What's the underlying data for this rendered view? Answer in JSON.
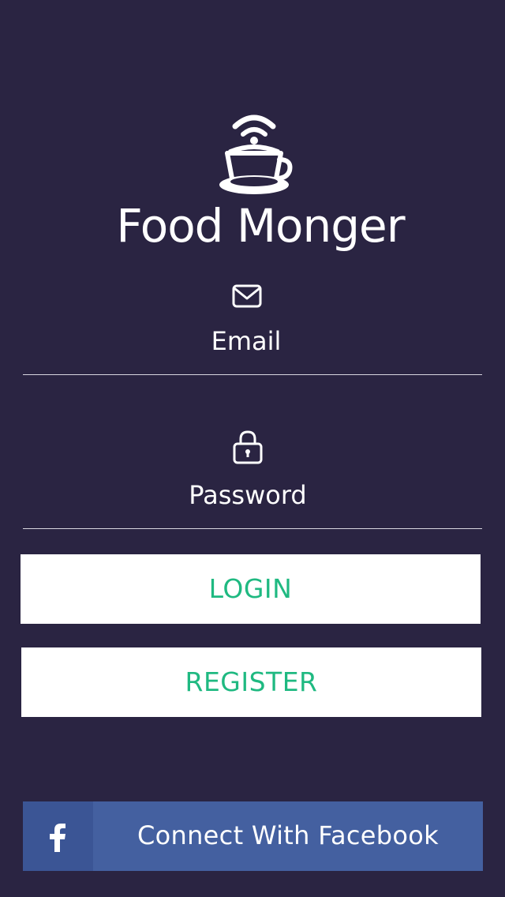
{
  "app": {
    "title": "Food Monger",
    "logo_icon": "coffee-cup-wifi-icon"
  },
  "login_form": {
    "email": {
      "icon": "envelope-icon",
      "placeholder": "Email",
      "value": ""
    },
    "password": {
      "icon": "lock-icon",
      "placeholder": "Password",
      "value": ""
    }
  },
  "buttons": {
    "login_label": "LOGIN",
    "register_label": "REGISTER",
    "facebook_label": "Connect With Facebook",
    "facebook_icon": "facebook-f-icon"
  },
  "colors": {
    "background": "#2a2442",
    "accent_text": "#1fb981",
    "facebook_blue": "#4460a0",
    "facebook_icon_bg": "#3b5595"
  }
}
